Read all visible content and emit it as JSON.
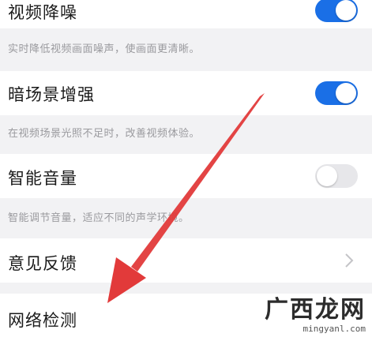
{
  "settings": [
    {
      "label": "视频降噪",
      "toggle": true,
      "description": "实时降低视频画面噪声，使画面更清晰。"
    },
    {
      "label": "暗场景增强",
      "toggle": true,
      "description": "在视频场景光照不足时，改善视频体验。"
    },
    {
      "label": "智能音量",
      "toggle": false,
      "description": "智能调节音量，适应不同的声学环境。"
    },
    {
      "label": "意见反馈",
      "chevron": true
    },
    {
      "label": "网络检测"
    }
  ],
  "colors": {
    "accent": "#1a6fe6",
    "toggle_off": "#e7e7ea",
    "arrow": "#e23a3a",
    "background": "#f2f2f4"
  },
  "icons": {
    "annotation": "red-arrow-icon",
    "chevron": "chevron-right-icon"
  },
  "watermark": {
    "logo_text": "广西龙网",
    "domain": "mingyanl.com"
  }
}
